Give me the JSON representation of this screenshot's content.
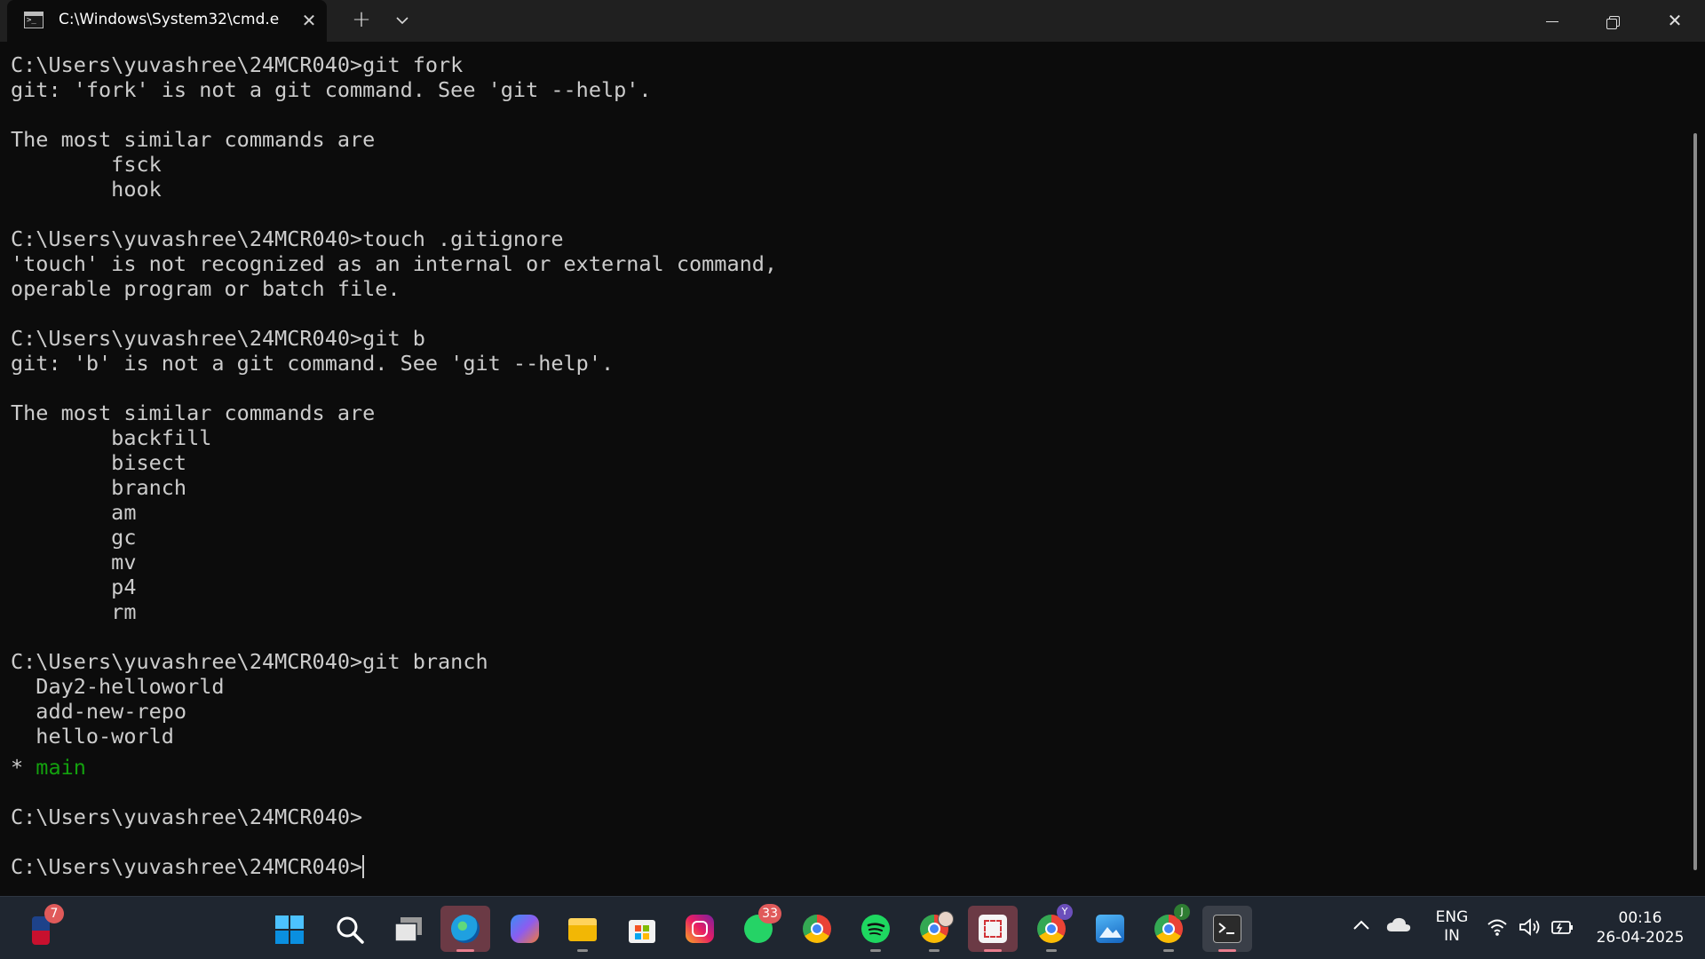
{
  "window": {
    "tab_title": "C:\\Windows\\System32\\cmd.e",
    "close_tab": "✕",
    "new_tab": "+",
    "dropdown": "⌄",
    "close_window": "✕"
  },
  "terminal": {
    "lines": [
      {
        "text": "C:\\Users\\yuvashree\\24MCR040>git fork"
      },
      {
        "text": "git: 'fork' is not a git command. See 'git --help'."
      },
      {
        "text": ""
      },
      {
        "text": "The most similar commands are"
      },
      {
        "text": "        fsck"
      },
      {
        "text": "        hook"
      },
      {
        "text": ""
      },
      {
        "text": "C:\\Users\\yuvashree\\24MCR040>touch .gitignore"
      },
      {
        "text": "'touch' is not recognized as an internal or external command,"
      },
      {
        "text": "operable program or batch file."
      },
      {
        "text": ""
      },
      {
        "text": "C:\\Users\\yuvashree\\24MCR040>git b"
      },
      {
        "text": "git: 'b' is not a git command. See 'git --help'."
      },
      {
        "text": ""
      },
      {
        "text": "The most similar commands are"
      },
      {
        "text": "        backfill"
      },
      {
        "text": "        bisect"
      },
      {
        "text": "        branch"
      },
      {
        "text": "        am"
      },
      {
        "text": "        gc"
      },
      {
        "text": "        mv"
      },
      {
        "text": "        p4"
      },
      {
        "text": "        rm"
      },
      {
        "text": ""
      },
      {
        "text": "C:\\Users\\yuvashree\\24MCR040>git branch"
      },
      {
        "text": "  Day2-helloworld"
      },
      {
        "text": "  add-new-repo"
      },
      {
        "text": "  hello-world"
      }
    ],
    "current_branch_prefix": "* ",
    "current_branch": "main",
    "prompt_1": "C:\\Users\\yuvashree\\24MCR040>",
    "prompt_2": "C:\\Users\\yuvashree\\24MCR040>"
  },
  "taskbar": {
    "nba_badge": "7",
    "whatsapp_badge": "33",
    "chrome_profile_y": "Y",
    "chrome_profile_j": "J",
    "apps": [
      "nba",
      "start",
      "search",
      "task-view",
      "edge",
      "copilot",
      "file-explorer",
      "microsoft-store",
      "instagram",
      "whatsapp",
      "chrome",
      "spotify",
      "chrome-profile",
      "snipping-tool",
      "chrome-y",
      "photos",
      "chrome-j",
      "terminal"
    ]
  },
  "tray": {
    "chevron": "^",
    "language": "ENG",
    "region": "IN",
    "time": "00:16",
    "date": "26-04-2025"
  },
  "colors": {
    "terminal_bg": "#0c0c0c",
    "terminal_text": "#cccccc",
    "branch_green": "#13a10e",
    "taskbar_bg": "#1f2630"
  }
}
